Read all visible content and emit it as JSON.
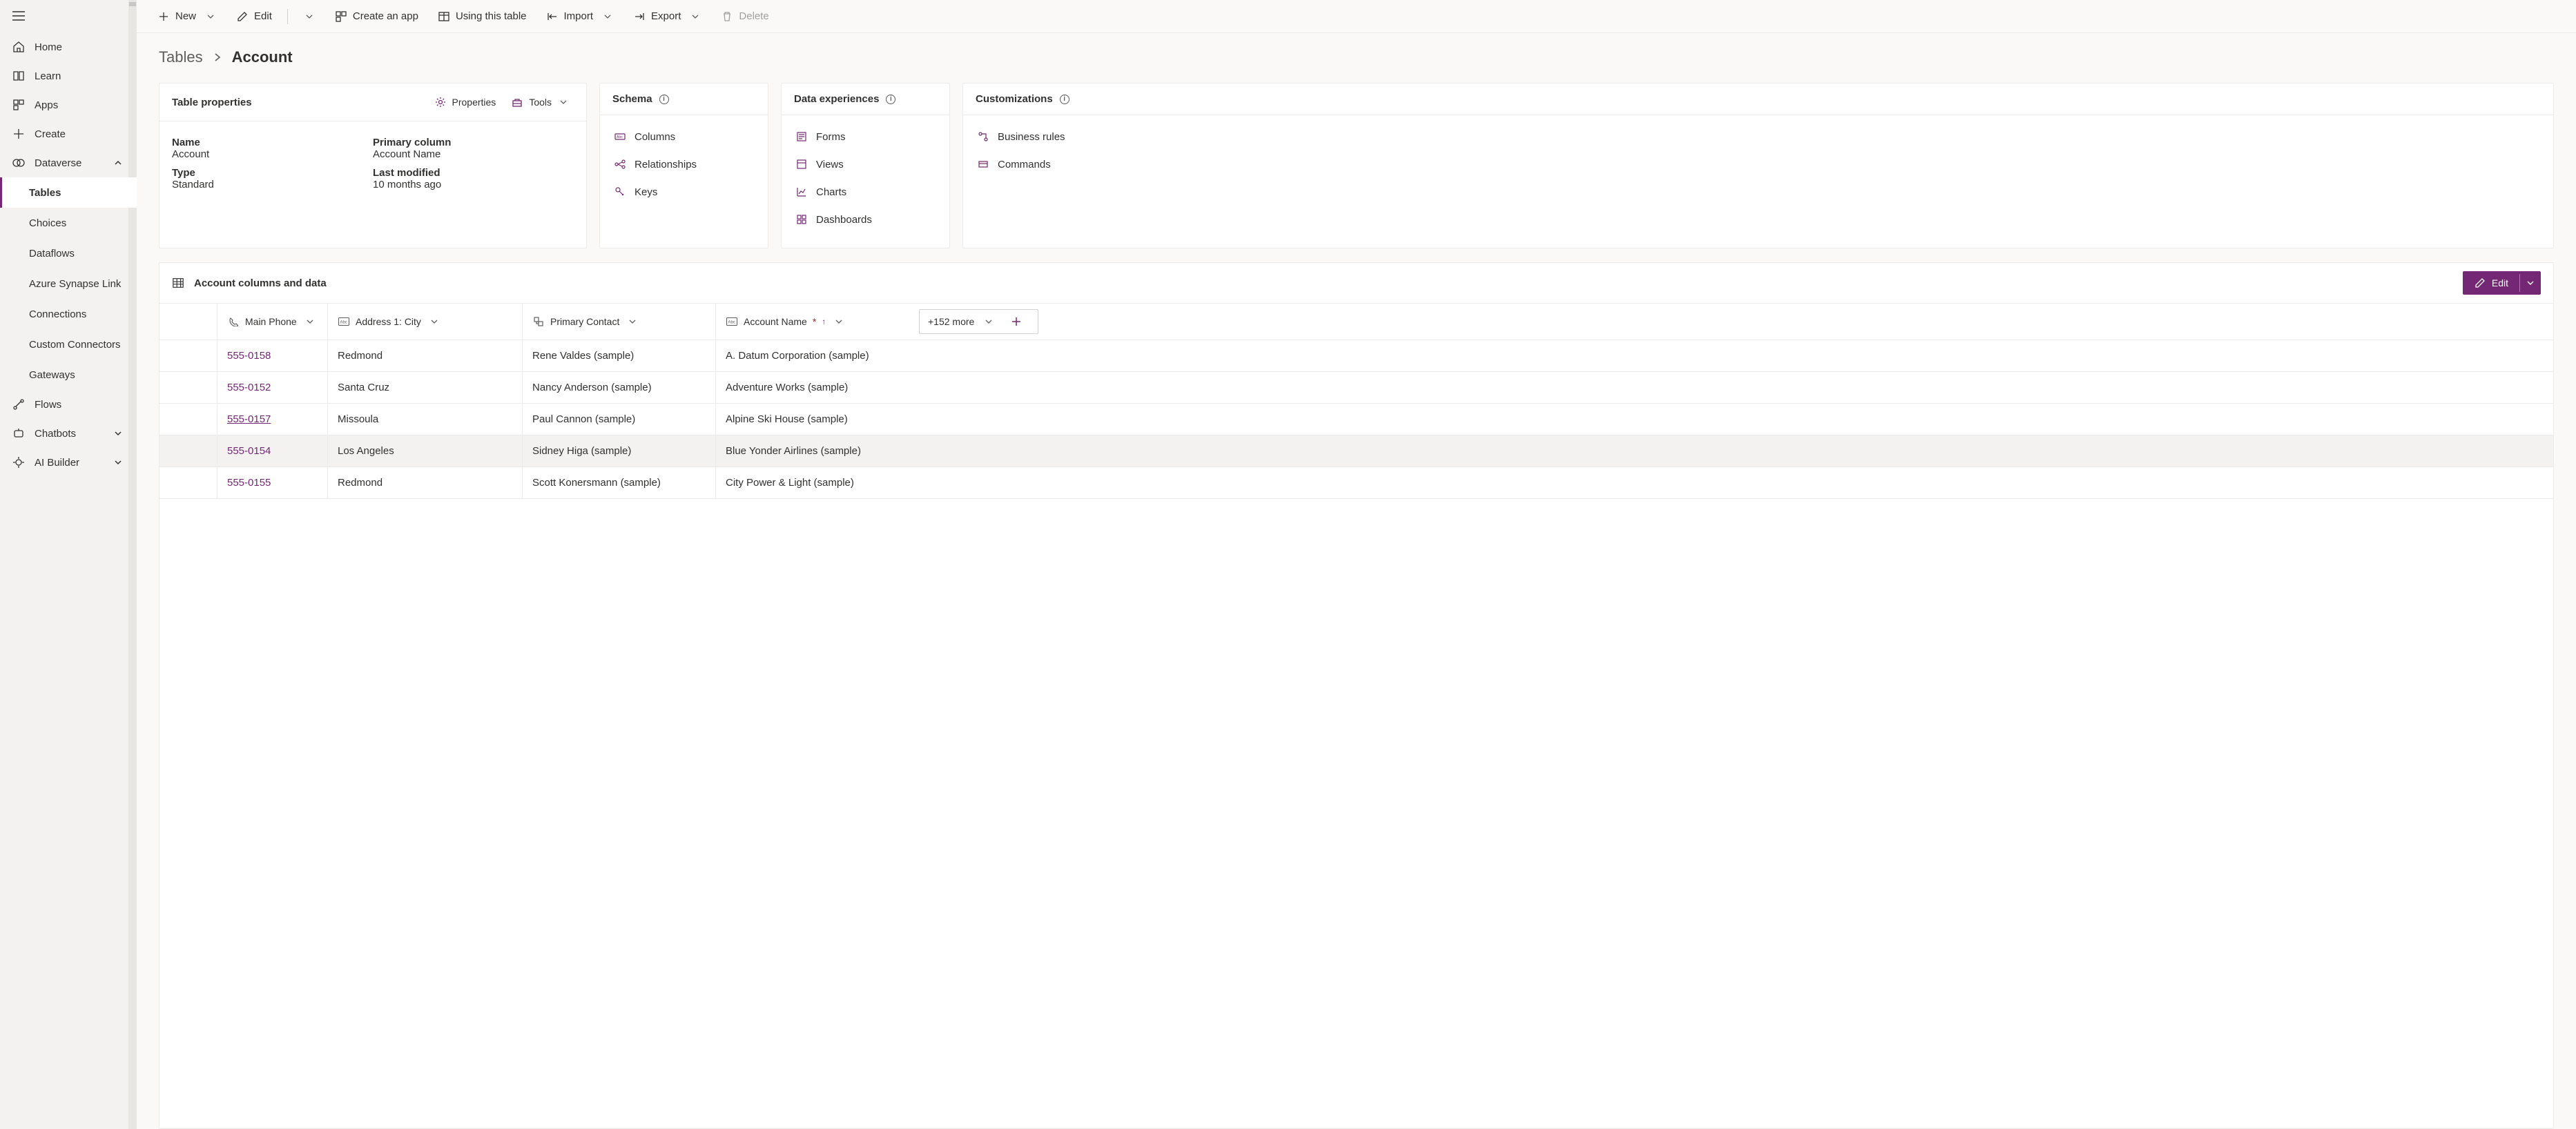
{
  "sidebar": {
    "items": [
      {
        "label": "Home"
      },
      {
        "label": "Learn"
      },
      {
        "label": "Apps"
      },
      {
        "label": "Create"
      },
      {
        "label": "Dataverse"
      },
      {
        "label": "Flows"
      },
      {
        "label": "Chatbots"
      },
      {
        "label": "AI Builder"
      }
    ],
    "dataverse_children": [
      {
        "label": "Tables"
      },
      {
        "label": "Choices"
      },
      {
        "label": "Dataflows"
      },
      {
        "label": "Azure Synapse Link"
      },
      {
        "label": "Connections"
      },
      {
        "label": "Custom Connectors"
      },
      {
        "label": "Gateways"
      }
    ]
  },
  "cmdbar": {
    "new": "New",
    "edit": "Edit",
    "create_app": "Create an app",
    "using_table": "Using this table",
    "import": "Import",
    "export": "Export",
    "delete": "Delete"
  },
  "breadcrumb": {
    "parent": "Tables",
    "current": "Account"
  },
  "cards": {
    "props": {
      "title": "Table properties",
      "properties_link": "Properties",
      "tools_link": "Tools",
      "name_label": "Name",
      "name_value": "Account",
      "pc_label": "Primary column",
      "pc_value": "Account Name",
      "type_label": "Type",
      "type_value": "Standard",
      "lm_label": "Last modified",
      "lm_value": "10 months ago"
    },
    "schema": {
      "title": "Schema",
      "links": [
        "Columns",
        "Relationships",
        "Keys"
      ]
    },
    "data_exp": {
      "title": "Data experiences",
      "links": [
        "Forms",
        "Views",
        "Charts",
        "Dashboards"
      ]
    },
    "custom": {
      "title": "Customizations",
      "links": [
        "Business rules",
        "Commands"
      ]
    }
  },
  "data_panel": {
    "title": "Account columns and data",
    "edit": "Edit",
    "more": "+152 more",
    "columns": {
      "phone": "Main Phone",
      "city": "Address 1: City",
      "contact": "Primary Contact",
      "account": "Account Name"
    },
    "rows": [
      {
        "phone": "555-0158",
        "city": "Redmond",
        "contact": "Rene Valdes (sample)",
        "account": "A. Datum Corporation (sample)"
      },
      {
        "phone": "555-0152",
        "city": "Santa Cruz",
        "contact": "Nancy Anderson (sample)",
        "account": "Adventure Works (sample)"
      },
      {
        "phone": "555-0157",
        "city": "Missoula",
        "contact": "Paul Cannon (sample)",
        "account": "Alpine Ski House (sample)"
      },
      {
        "phone": "555-0154",
        "city": "Los Angeles",
        "contact": "Sidney Higa (sample)",
        "account": "Blue Yonder Airlines (sample)"
      },
      {
        "phone": "555-0155",
        "city": "Redmond",
        "contact": "Scott Konersmann (sample)",
        "account": "City Power & Light (sample)"
      }
    ]
  }
}
